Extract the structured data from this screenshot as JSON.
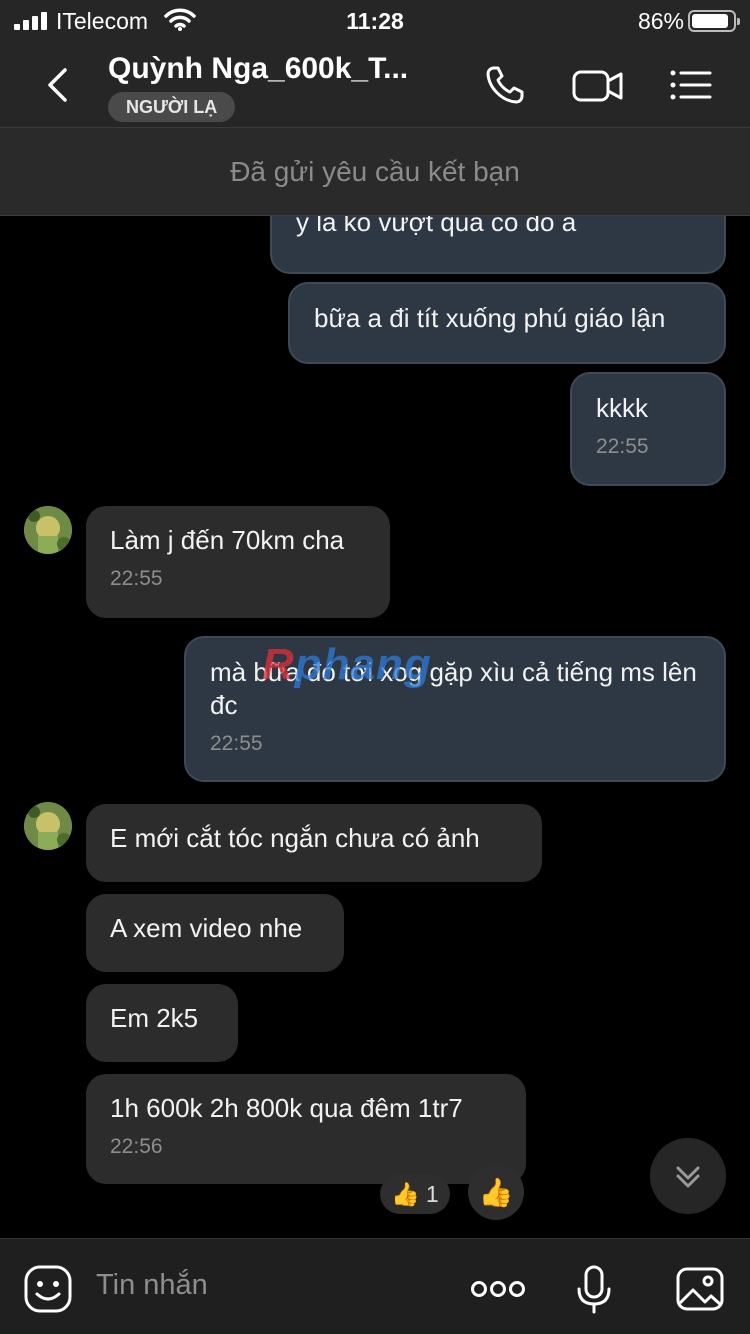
{
  "status_bar": {
    "carrier": "ITelecom",
    "time": "11:28",
    "battery": "86%"
  },
  "header": {
    "title": "Quỳnh Nga_600k_T...",
    "badge": "NGƯỜI LẠ"
  },
  "request_bar": {
    "text": "Đã gửi yêu cầu kết bạn"
  },
  "messages": [
    {
      "dir": "out",
      "text": "y là ko vượt qua có đó á",
      "time": ""
    },
    {
      "dir": "out",
      "text": "bữa a đi tít xuống phú giáo lận",
      "time": ""
    },
    {
      "dir": "out",
      "text": "kkkk",
      "time": "22:55"
    },
    {
      "dir": "in",
      "text": "Làm j đến 70km cha",
      "time": "22:55"
    },
    {
      "dir": "out",
      "text": "mà bữa đó tới xog gặp xìu cả tiếng ms lên đc",
      "time": "22:55"
    },
    {
      "dir": "in",
      "text": "E mới cắt tóc ngắn chưa có ảnh",
      "time": ""
    },
    {
      "dir": "in",
      "text": "A xem video nhe",
      "time": ""
    },
    {
      "dir": "in",
      "text": "Em 2k5",
      "time": ""
    },
    {
      "dir": "in",
      "text": "1h 600k 2h 800k qua đêm 1tr7",
      "time": "22:56"
    }
  ],
  "watermark": {
    "part1": "R",
    "part2": "phang"
  },
  "reaction": {
    "emoji": "👍",
    "count": "1"
  },
  "composer": {
    "placeholder": "Tin nhắn"
  },
  "icons": [
    "back-icon",
    "phone-icon",
    "video-call-icon",
    "menu-icon",
    "sticker-icon",
    "more-icon",
    "microphone-icon",
    "image-icon",
    "chevron-down-icon",
    "thumbs-up-icon"
  ]
}
